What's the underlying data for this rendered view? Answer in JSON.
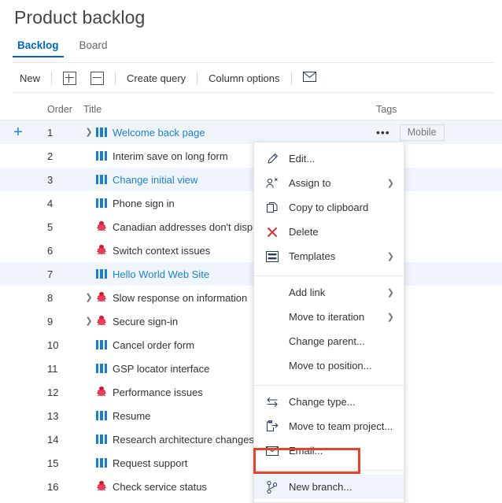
{
  "page": {
    "title": "Product backlog"
  },
  "tabs": [
    {
      "label": "Backlog",
      "selected": true
    },
    {
      "label": "Board",
      "selected": false
    }
  ],
  "toolbar": {
    "new_label": "New",
    "expand_icon": "plus-box-icon",
    "collapse_icon": "minus-box-icon",
    "create_query_label": "Create query",
    "column_options_label": "Column options",
    "email_icon": "envelope-icon"
  },
  "grid": {
    "columns": [
      "Order",
      "Title",
      "Tags"
    ],
    "rows": [
      {
        "order": "1",
        "title": "Welcome back page",
        "type": "story",
        "expander": true,
        "link": true,
        "highlighted": true,
        "tag": "Mobile",
        "ellipsis": "•••"
      },
      {
        "order": "2",
        "title": "Interim save on long form",
        "type": "story",
        "expander": false,
        "link": false,
        "highlighted": false,
        "tag": ""
      },
      {
        "order": "3",
        "title": "Change initial view",
        "type": "story",
        "expander": false,
        "link": true,
        "highlighted": true,
        "tag": ""
      },
      {
        "order": "4",
        "title": "Phone sign in",
        "type": "story",
        "expander": false,
        "link": false,
        "highlighted": false,
        "tag": ""
      },
      {
        "order": "5",
        "title": "Canadian addresses don't disp",
        "type": "bug",
        "expander": false,
        "link": false,
        "highlighted": false,
        "tag": ""
      },
      {
        "order": "6",
        "title": "Switch context issues",
        "type": "bug",
        "expander": false,
        "link": false,
        "highlighted": false,
        "tag": ""
      },
      {
        "order": "7",
        "title": "Hello World Web Site",
        "type": "story",
        "expander": false,
        "link": true,
        "highlighted": true,
        "tag": ""
      },
      {
        "order": "8",
        "title": "Slow response on information",
        "type": "bug",
        "expander": true,
        "link": false,
        "highlighted": false,
        "tag": ""
      },
      {
        "order": "9",
        "title": "Secure sign-in",
        "type": "bug",
        "expander": true,
        "link": false,
        "highlighted": false,
        "tag": ""
      },
      {
        "order": "10",
        "title": "Cancel order form",
        "type": "story",
        "expander": false,
        "link": false,
        "highlighted": false,
        "tag": ""
      },
      {
        "order": "11",
        "title": "GSP locator interface",
        "type": "story",
        "expander": false,
        "link": false,
        "highlighted": false,
        "tag": ""
      },
      {
        "order": "12",
        "title": "Performance issues",
        "type": "bug",
        "expander": false,
        "link": false,
        "highlighted": false,
        "tag": ""
      },
      {
        "order": "13",
        "title": "Resume",
        "type": "story",
        "expander": false,
        "link": false,
        "highlighted": false,
        "tag": ""
      },
      {
        "order": "14",
        "title": "Research architecture changes",
        "type": "story",
        "expander": false,
        "link": false,
        "highlighted": false,
        "tag": ""
      },
      {
        "order": "15",
        "title": "Request support",
        "type": "story",
        "expander": false,
        "link": false,
        "highlighted": false,
        "tag": ""
      },
      {
        "order": "16",
        "title": "Check service status",
        "type": "bug",
        "expander": false,
        "link": false,
        "highlighted": false,
        "tag": ""
      }
    ],
    "add_row_handle": "+"
  },
  "context_menu": {
    "groups": [
      {
        "items": [
          {
            "label": "Edit...",
            "icon": "pencil-icon",
            "submenu": false
          },
          {
            "label": "Assign to",
            "icon": "person-icon",
            "submenu": true
          },
          {
            "label": "Copy to clipboard",
            "icon": "copy-icon",
            "submenu": false
          },
          {
            "label": "Delete",
            "icon": "close-x-icon",
            "submenu": false
          },
          {
            "label": "Templates",
            "icon": "templates-icon",
            "submenu": true
          }
        ]
      },
      {
        "items": [
          {
            "label": "Add link",
            "icon": "none",
            "submenu": true
          },
          {
            "label": "Move to iteration",
            "icon": "none",
            "submenu": true
          },
          {
            "label": "Change parent...",
            "icon": "none",
            "submenu": false
          },
          {
            "label": "Move to position...",
            "icon": "none",
            "submenu": false
          }
        ]
      },
      {
        "items": [
          {
            "label": "Change type...",
            "icon": "swap-icon",
            "submenu": false
          },
          {
            "label": "Move to team project...",
            "icon": "move-out-icon",
            "submenu": false
          },
          {
            "label": "Email...",
            "icon": "envelope-icon",
            "submenu": false
          }
        ]
      },
      {
        "items": [
          {
            "label": "New branch...",
            "icon": "branch-icon",
            "submenu": false,
            "highlighted": true
          }
        ]
      }
    ]
  },
  "annotation": {
    "highlight_color": "#e8402a",
    "target": "New branch..."
  },
  "colors": {
    "accent": "#0069ba",
    "link": "#1f7fd0",
    "row_highlight": "#eff5fb",
    "bug": "#cf1c3c",
    "story": "#1b7ec9",
    "delete_x": "#d13438"
  }
}
